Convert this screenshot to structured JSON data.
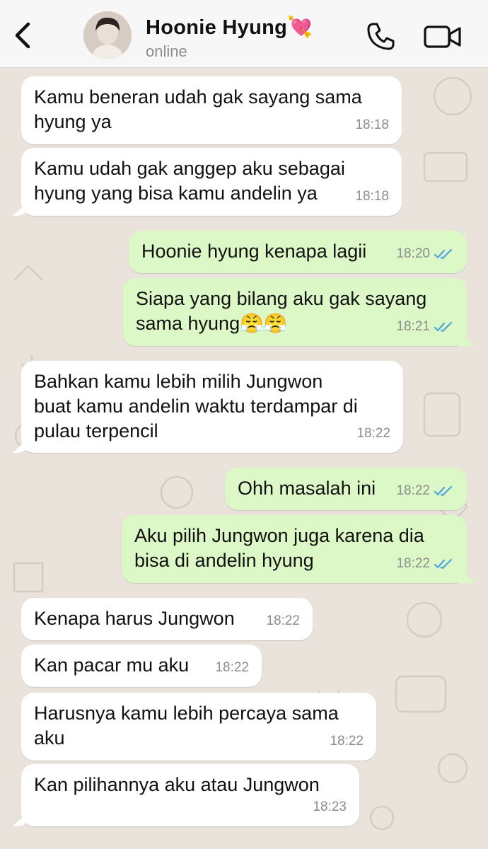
{
  "header": {
    "back_icon": "chevron-left-icon",
    "contact_name": "Hoonie Hyung💘",
    "status": "online",
    "call_icon": "phone-icon",
    "video_icon": "video-camera-icon"
  },
  "colors": {
    "incoming_bubble": "#ffffff",
    "outgoing_bubble": "#dcf8c6",
    "read_ticks": "#4fa3e0",
    "chat_background": "#e9e3dc"
  },
  "messages": [
    {
      "dir": "in",
      "text": "Kamu beneran udah gak sayang sama\nhyung ya",
      "time": "18:18"
    },
    {
      "dir": "in",
      "text": "Kamu udah gak anggep aku sebagai\nhyung yang bisa kamu andelin ya",
      "time": "18:18"
    },
    {
      "dir": "out",
      "text": "Hoonie hyung kenapa lagii",
      "time": "18:20",
      "read": true
    },
    {
      "dir": "out",
      "text": "Siapa yang bilang aku gak sayang\nsama hyung😤😤",
      "time": "18:21",
      "read": true
    },
    {
      "dir": "in",
      "text": "Bahkan kamu lebih milih Jungwon\nbuat kamu andelin waktu terdampar di\npulau terpencil",
      "time": "18:22"
    },
    {
      "dir": "out",
      "text": "Ohh masalah ini",
      "time": "18:22",
      "read": true
    },
    {
      "dir": "out",
      "text": "Aku pilih Jungwon juga karena dia\nbisa di andelin hyung",
      "time": "18:22",
      "read": true
    },
    {
      "dir": "in",
      "text": "Kenapa harus Jungwon",
      "time": "18:22"
    },
    {
      "dir": "in",
      "text": "Kan pacar mu aku",
      "time": "18:22"
    },
    {
      "dir": "in",
      "text": "Harusnya kamu lebih percaya sama\naku",
      "time": "18:22"
    },
    {
      "dir": "in",
      "text": "Kan pilihannya aku atau Jungwon",
      "time": "18:23"
    }
  ]
}
